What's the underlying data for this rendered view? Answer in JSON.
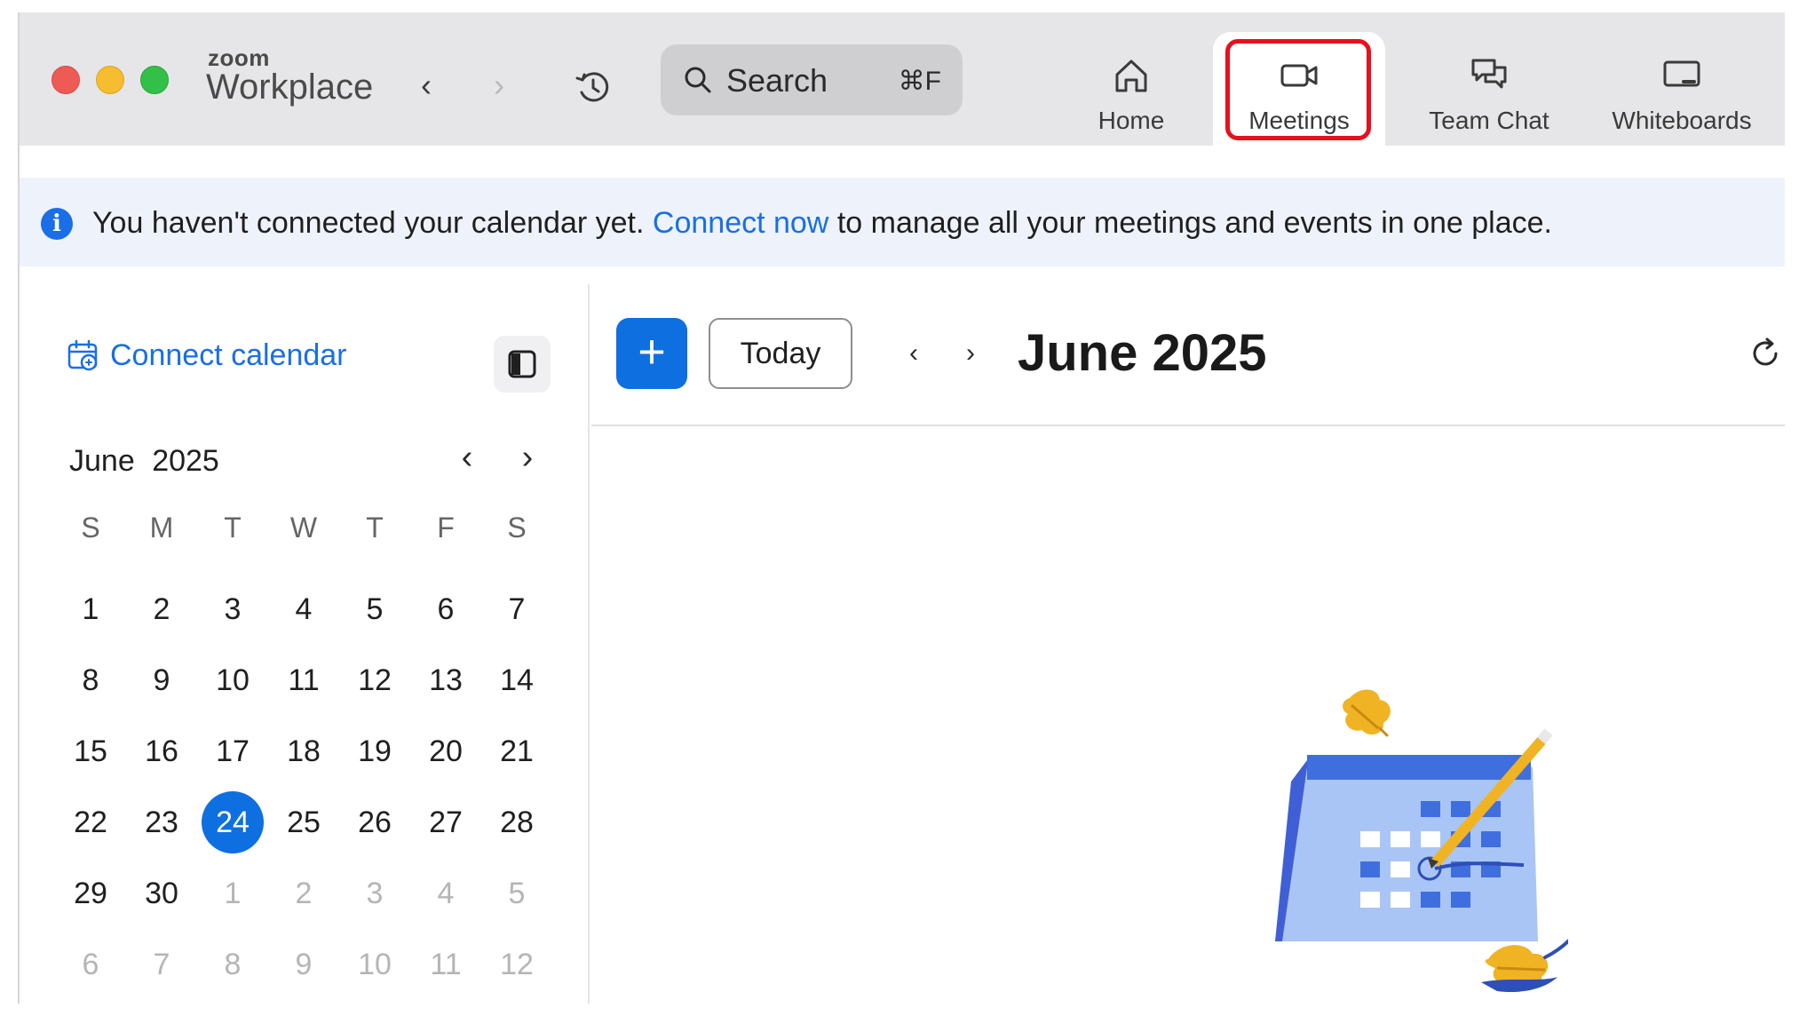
{
  "app": {
    "brand_small": "zoom",
    "brand_name": "Workplace"
  },
  "titlebar": {
    "back_arrow": "‹",
    "forward_arrow": "›",
    "history_icon": "history-icon",
    "search": {
      "label": "Search",
      "shortcut": "⌘F"
    },
    "tabs": [
      {
        "label": "Home",
        "icon": "home-icon",
        "active": false
      },
      {
        "label": "Meetings",
        "icon": "video-camera-icon",
        "active": true
      },
      {
        "label": "Team Chat",
        "icon": "chat-bubbles-icon",
        "active": false
      },
      {
        "label": "Whiteboards",
        "icon": "whiteboard-icon",
        "active": false
      }
    ]
  },
  "banner": {
    "icon": "info-icon",
    "text_before": "You haven't connected your calendar yet.",
    "link": "Connect now",
    "text_after": "to manage all your meetings and events in one place."
  },
  "sidebar": {
    "connect_calendar": "Connect calendar",
    "mini_calendar": {
      "month": "June",
      "year": "2025",
      "prev": "‹",
      "next": "›",
      "weekdays": [
        "S",
        "M",
        "T",
        "W",
        "T",
        "F",
        "S"
      ],
      "days": [
        {
          "d": "1",
          "muted": false
        },
        {
          "d": "2",
          "muted": false
        },
        {
          "d": "3",
          "muted": false
        },
        {
          "d": "4",
          "muted": false
        },
        {
          "d": "5",
          "muted": false
        },
        {
          "d": "6",
          "muted": false
        },
        {
          "d": "7",
          "muted": false
        },
        {
          "d": "8",
          "muted": false
        },
        {
          "d": "9",
          "muted": false
        },
        {
          "d": "10",
          "muted": false
        },
        {
          "d": "11",
          "muted": false
        },
        {
          "d": "12",
          "muted": false
        },
        {
          "d": "13",
          "muted": false
        },
        {
          "d": "14",
          "muted": false
        },
        {
          "d": "15",
          "muted": false
        },
        {
          "d": "16",
          "muted": false
        },
        {
          "d": "17",
          "muted": false
        },
        {
          "d": "18",
          "muted": false
        },
        {
          "d": "19",
          "muted": false
        },
        {
          "d": "20",
          "muted": false
        },
        {
          "d": "21",
          "muted": false
        },
        {
          "d": "22",
          "muted": false
        },
        {
          "d": "23",
          "muted": false
        },
        {
          "d": "24",
          "muted": false,
          "selected": true
        },
        {
          "d": "25",
          "muted": false
        },
        {
          "d": "26",
          "muted": false
        },
        {
          "d": "27",
          "muted": false
        },
        {
          "d": "28",
          "muted": false
        },
        {
          "d": "29",
          "muted": false
        },
        {
          "d": "30",
          "muted": false
        },
        {
          "d": "1",
          "muted": true
        },
        {
          "d": "2",
          "muted": true
        },
        {
          "d": "3",
          "muted": true
        },
        {
          "d": "4",
          "muted": true
        },
        {
          "d": "5",
          "muted": true
        },
        {
          "d": "6",
          "muted": true
        },
        {
          "d": "7",
          "muted": true
        },
        {
          "d": "8",
          "muted": true
        },
        {
          "d": "9",
          "muted": true
        },
        {
          "d": "10",
          "muted": true
        },
        {
          "d": "11",
          "muted": true
        },
        {
          "d": "12",
          "muted": true
        }
      ]
    }
  },
  "main": {
    "add_label": "+",
    "today_label": "Today",
    "prev": "‹",
    "next": "›",
    "title": "June 2025"
  },
  "colors": {
    "accent": "#0e6fe0",
    "link": "#1a6ee6",
    "highlight": "#e8101c",
    "titlebar_bg": "#e6e6e8",
    "banner_bg": "#eef3fb"
  }
}
